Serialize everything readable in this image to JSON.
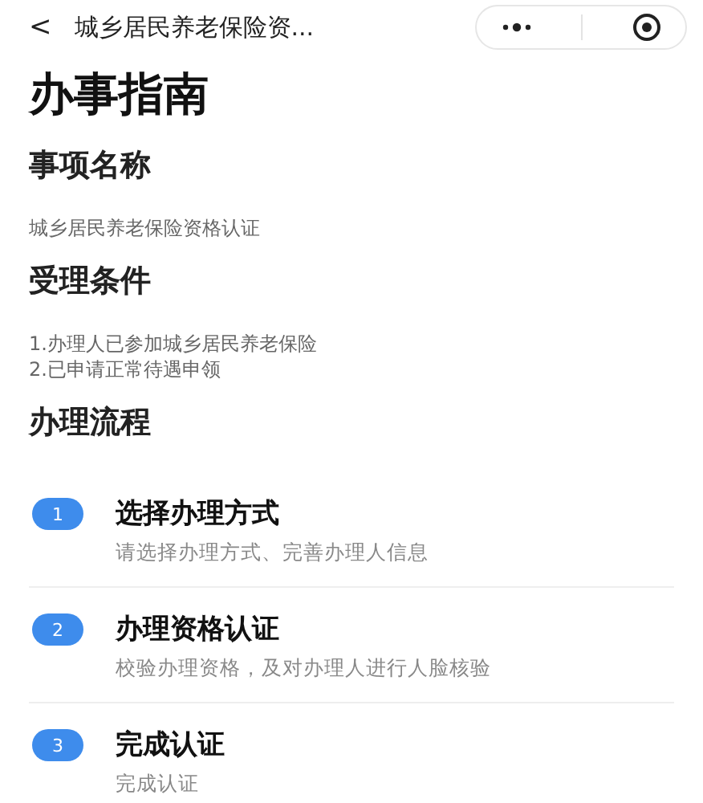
{
  "nav": {
    "back": "<",
    "title": "城乡居民养老保险资..."
  },
  "page_title": "办事指南",
  "sections": [
    {
      "heading": "事项名称",
      "kind": "text",
      "lines": [
        "城乡居民养老保险资格认证"
      ]
    },
    {
      "heading": "受理条件",
      "kind": "text",
      "lines": [
        "1.办理人已参加城乡居民养老保险",
        "2.已申请正常待遇申领"
      ]
    },
    {
      "heading": "办理流程",
      "kind": "steps",
      "steps": [
        {
          "number": "1",
          "title": "选择办理方式",
          "desc": "请选择办理方式、完善办理人信息"
        },
        {
          "number": "2",
          "title": "办理资格认证",
          "desc": "校验办理资格，及对办理人进行人脸核验"
        },
        {
          "number": "3",
          "title": "完成认证",
          "desc": "完成认证"
        }
      ]
    }
  ]
}
